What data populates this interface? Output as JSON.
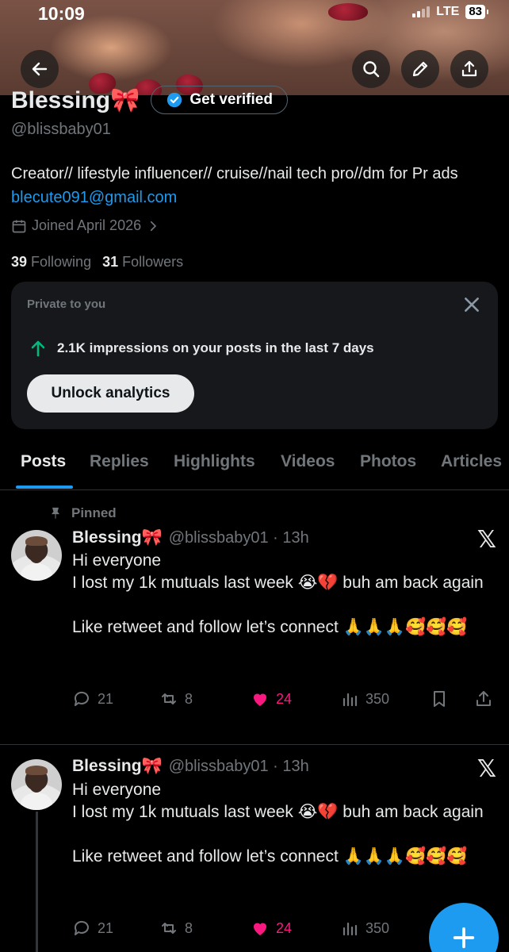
{
  "status_bar": {
    "time": "10:09",
    "network": "LTE",
    "battery": "83"
  },
  "header": {
    "back": "back-icon",
    "search": "search-icon",
    "edit": "pencil-icon",
    "share": "share-icon"
  },
  "profile": {
    "name": "Blessing🎀",
    "verify_label": "Get verified",
    "handle": "@blissbaby01",
    "bio_text": "Creator// lifestyle influencer// cruise//nail tech pro//dm for Pr ads ",
    "bio_link": "blecute091@gmail.com",
    "joined": "Joined April 2026",
    "following_count": "39",
    "following_label": "Following",
    "followers_count": "31",
    "followers_label": "Followers"
  },
  "private_card": {
    "title": "Private to you",
    "impressions": "2.1K impressions on your posts in the last 7 days",
    "button": "Unlock analytics"
  },
  "tabs": [
    "Posts",
    "Replies",
    "Highlights",
    "Videos",
    "Photos",
    "Articles"
  ],
  "posts": [
    {
      "pinned_label": "Pinned",
      "name": "Blessing🎀",
      "meta": "@blissbaby01 · 13h",
      "text": "Hi everyone\nI lost my 1k mutuals last week 😭💔 buh am back again\n\nLike retweet and follow let’s connect 🙏🙏🙏🥰🥰🥰",
      "replies": "21",
      "reposts": "8",
      "likes": "24",
      "views": "350"
    },
    {
      "name": "Blessing🎀",
      "meta": "@blissbaby01 · 13h",
      "text": "Hi everyone\nI lost my 1k mutuals last week 😭💔 buh am back again\n\nLike retweet and follow let’s connect 🙏🙏🙏🥰🥰🥰",
      "replies": "21",
      "reposts": "8",
      "likes": "24",
      "views": "350"
    }
  ],
  "colors": {
    "accent": "#1d9bf0",
    "like": "#f91880",
    "growth": "#00ba7c",
    "muted": "#71767b"
  }
}
